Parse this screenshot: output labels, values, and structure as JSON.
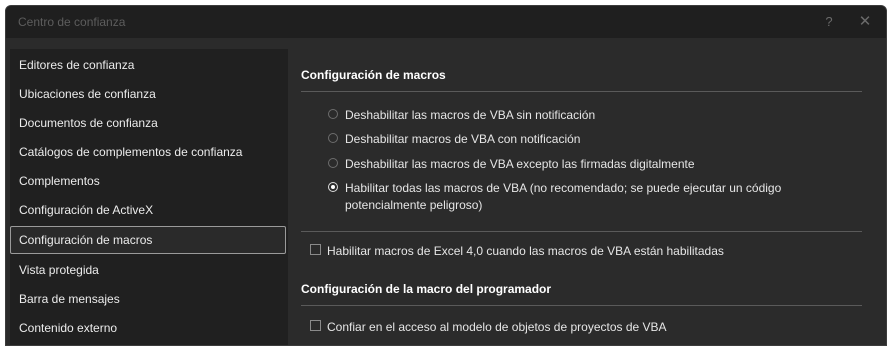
{
  "window": {
    "title": "Centro de confianza",
    "help_label": "?",
    "close_label": "✕"
  },
  "sidebar": {
    "items": [
      {
        "label": "Editores de confianza"
      },
      {
        "label": "Ubicaciones de confianza"
      },
      {
        "label": "Documentos de confianza"
      },
      {
        "label": "Catálogos de complementos de confianza"
      },
      {
        "label": "Complementos"
      },
      {
        "label": "Configuración de ActiveX"
      },
      {
        "label": "Configuración de macros"
      },
      {
        "label": "Vista protegida"
      },
      {
        "label": "Barra de mensajes"
      },
      {
        "label": "Contenido externo"
      }
    ],
    "selected": "Configuración de macros"
  },
  "macro_settings": {
    "title": "Configuración de macros",
    "options": [
      {
        "label": "Deshabilitar las macros de VBA sin notificación",
        "checked": false
      },
      {
        "label": "Deshabilitar macros de VBA con notificación",
        "checked": false
      },
      {
        "label": "Deshabilitar las macros de VBA excepto las firmadas digitalmente",
        "checked": false
      },
      {
        "label_line1": "Habilitar todas las macros de VBA (no recomendado; se puede ejecutar un código",
        "label_line2": "potencialmente peligroso)",
        "checked": true
      }
    ],
    "excel4_checkbox": {
      "label": "Habilitar macros de Excel 4,0 cuando las macros de VBA están habilitadas",
      "checked": false
    }
  },
  "developer_settings": {
    "title": "Configuración de la macro del programador",
    "trust_vba_checkbox": {
      "label": "Confiar en el acceso al modelo de objetos de proyectos de VBA",
      "checked": false
    }
  }
}
